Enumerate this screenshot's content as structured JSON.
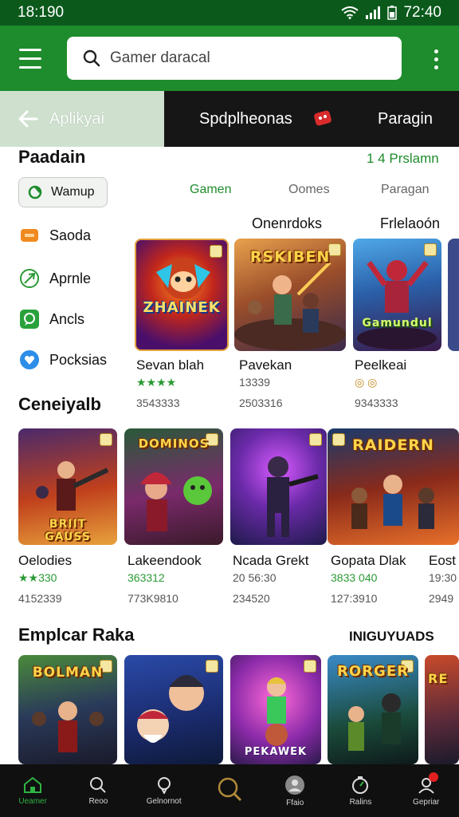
{
  "status_bar": {
    "left": "18:190",
    "time": "72:40"
  },
  "search": {
    "placeholder": "Gamer daracal"
  },
  "tabs": {
    "back_label": "Aplikyai",
    "tab1": "Spdplheonas",
    "tab2": "Paragin"
  },
  "section1": {
    "title": "Paadain",
    "link": "1 4 Prslamn"
  },
  "chip": {
    "label": "Wamup"
  },
  "filters": {
    "tab1": "Gamen",
    "tab2": "Oomes",
    "tab3": "Paragan"
  },
  "categories": [
    {
      "label": "Saoda",
      "icon": "orange-tag-icon"
    },
    {
      "label": "Aprnle",
      "icon": "leaf-icon"
    },
    {
      "label": "Ancls",
      "icon": "chat-bubble-icon"
    },
    {
      "label": "Pocksias",
      "icon": "blue-heart-icon"
    }
  ],
  "col_headers": {
    "a": "Onenrdoks",
    "b": "Frlelaoón"
  },
  "row1": [
    {
      "logo": "ZHAINEK",
      "name": "Sevan blah",
      "rating": "★★★★",
      "meta": "3543333"
    },
    {
      "logo": "RSKIBEN",
      "name": "Pavekan",
      "rating": "",
      "meta": "13339",
      "meta2": "2503316"
    },
    {
      "logo": "Gamundul",
      "name": "Peelkeai",
      "rating": "◎ ◎",
      "meta": "9343333"
    }
  ],
  "section2": {
    "title": "Ceneiyalb"
  },
  "row2": [
    {
      "logo": "BRIIT GAUSS",
      "name": "Oelodies",
      "rating": "★★330",
      "meta": "4152339"
    },
    {
      "logo": "DOMINOS",
      "name": "Lakeendook",
      "rating": "363312",
      "meta": "773K9810"
    },
    {
      "logo": "",
      "name": "Ncada Grekt",
      "rating": "20 56:30",
      "meta": "234520"
    },
    {
      "logo": "RAIDERN",
      "name": "Gopata Dlak",
      "rating": "3833 040",
      "meta": "127:3910"
    },
    {
      "logo": "",
      "name": "Eost",
      "rating": "19:30",
      "meta": "2949"
    }
  ],
  "section3": {
    "title": "Emplcar Raka",
    "link": "INIGUYUADS"
  },
  "row3": [
    {
      "logo": "BOLMAN"
    },
    {
      "logo": ""
    },
    {
      "logo": "PEKAWEK"
    },
    {
      "logo": "RORGER"
    },
    {
      "logo": "RE"
    }
  ],
  "bottom_nav": [
    {
      "label": "Ueamer",
      "icon": "home-icon"
    },
    {
      "label": "Reoo",
      "icon": "search-icon"
    },
    {
      "label": "Gelnornot",
      "icon": "pin-icon"
    },
    {
      "label": "",
      "icon": "magnifier-icon"
    },
    {
      "label": "Ffaio",
      "icon": "profile-icon"
    },
    {
      "label": "Ralins",
      "icon": "timer-icon"
    },
    {
      "label": "Gepriar",
      "icon": "account-icon"
    }
  ],
  "colors": {
    "brand_green": "#1e8c2c",
    "dark_green": "#0b5a1c"
  }
}
